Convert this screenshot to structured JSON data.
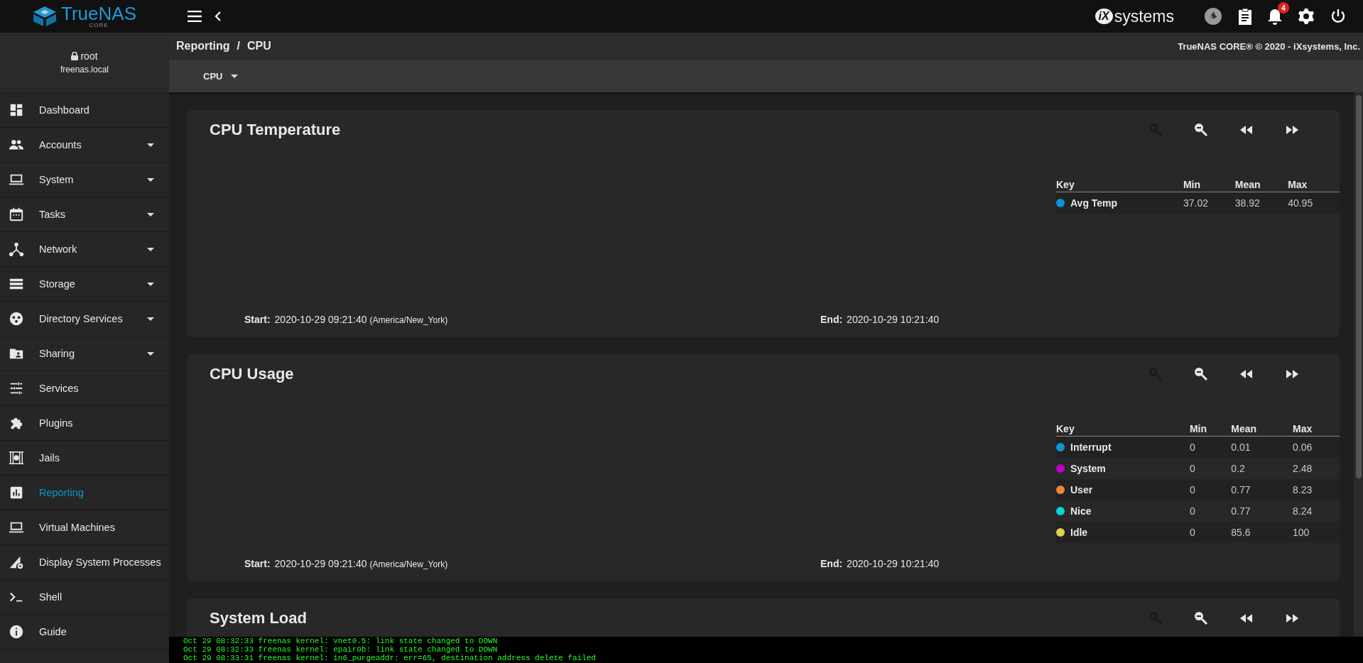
{
  "topbar": {
    "logo_text": "TrueNAS",
    "logo_sub": "CORE",
    "brand_mark": "iX",
    "brand_text": "systems",
    "notification_count": "4"
  },
  "user": {
    "name": "root",
    "host": "freenas.local"
  },
  "sidebar": {
    "items": [
      {
        "label": "Dashboard",
        "has_submenu": false,
        "selected": false
      },
      {
        "label": "Accounts",
        "has_submenu": true,
        "selected": false
      },
      {
        "label": "System",
        "has_submenu": true,
        "selected": false
      },
      {
        "label": "Tasks",
        "has_submenu": true,
        "selected": false
      },
      {
        "label": "Network",
        "has_submenu": true,
        "selected": false
      },
      {
        "label": "Storage",
        "has_submenu": true,
        "selected": false
      },
      {
        "label": "Directory Services",
        "has_submenu": true,
        "selected": false
      },
      {
        "label": "Sharing",
        "has_submenu": true,
        "selected": false
      },
      {
        "label": "Services",
        "has_submenu": false,
        "selected": false
      },
      {
        "label": "Plugins",
        "has_submenu": false,
        "selected": false
      },
      {
        "label": "Jails",
        "has_submenu": false,
        "selected": false
      },
      {
        "label": "Reporting",
        "has_submenu": false,
        "selected": true
      },
      {
        "label": "Virtual Machines",
        "has_submenu": false,
        "selected": false
      },
      {
        "label": "Display System Processes",
        "has_submenu": false,
        "selected": false
      },
      {
        "label": "Shell",
        "has_submenu": false,
        "selected": false
      },
      {
        "label": "Guide",
        "has_submenu": false,
        "selected": false
      }
    ]
  },
  "breadcrumb": {
    "items": [
      "Reporting",
      "CPU"
    ],
    "separator": "/"
  },
  "copyright": "TrueNAS CORE® © 2020 - iXsystems, Inc.",
  "toolbar": {
    "dropdown": "CPU"
  },
  "cards": [
    {
      "title": "CPU Temperature",
      "controls": [
        {
          "kind": "zoom-in",
          "disabled": true
        },
        {
          "kind": "zoom-out",
          "disabled": false
        },
        {
          "kind": "back",
          "disabled": false
        },
        {
          "kind": "forward",
          "disabled": false
        }
      ],
      "legend": {
        "columns": [
          "Key",
          "Min",
          "Mean",
          "Max"
        ],
        "rows": [
          {
            "name": "Avg Temp",
            "color": "#0a95d5",
            "min": "37.02",
            "mean": "38.92",
            "max": "40.95"
          }
        ]
      },
      "start_label": "Start:",
      "start": "2020-10-29 09:21:40",
      "timezone": "(America/New_York)",
      "end_label": "End:",
      "end": "2020-10-29 10:21:40"
    },
    {
      "title": "CPU Usage",
      "controls": [
        {
          "kind": "zoom-in",
          "disabled": true
        },
        {
          "kind": "zoom-out",
          "disabled": false
        },
        {
          "kind": "back",
          "disabled": false
        },
        {
          "kind": "forward",
          "disabled": false
        }
      ],
      "legend": {
        "columns": [
          "Key",
          "Min",
          "Mean",
          "Max"
        ],
        "rows": [
          {
            "name": "Interrupt",
            "color": "#0a95d5",
            "min": "0",
            "mean": "0.01",
            "max": "0.06"
          },
          {
            "name": "System",
            "color": "#c000c0",
            "min": "0",
            "mean": "0.2",
            "max": "2.48"
          },
          {
            "name": "User",
            "color": "#e8883a",
            "min": "0",
            "mean": "0.77",
            "max": "8.23"
          },
          {
            "name": "Nice",
            "color": "#0ed2d8",
            "min": "0",
            "mean": "0.77",
            "max": "8.24"
          },
          {
            "name": "Idle",
            "color": "#ddd04a",
            "min": "0",
            "mean": "85.6",
            "max": "100"
          }
        ]
      },
      "start_label": "Start:",
      "start": "2020-10-29 09:21:40",
      "timezone": "(America/New_York)",
      "end_label": "End:",
      "end": "2020-10-29 10:21:40"
    },
    {
      "title": "System Load",
      "controls": [
        {
          "kind": "zoom-in",
          "disabled": true
        },
        {
          "kind": "zoom-out",
          "disabled": false
        },
        {
          "kind": "back",
          "disabled": false
        },
        {
          "kind": "forward",
          "disabled": false
        }
      ]
    }
  ],
  "console": [
    "Oct 29 08:32:33 freenas kernel: vnet0.5: link state changed to DOWN",
    "Oct 29 08:32:33 freenas kernel: epair0b: link state changed to DOWN",
    "Oct 29 08:33:31 freenas kernel: in6_purgeaddr: err=65, destination address delete failed"
  ]
}
